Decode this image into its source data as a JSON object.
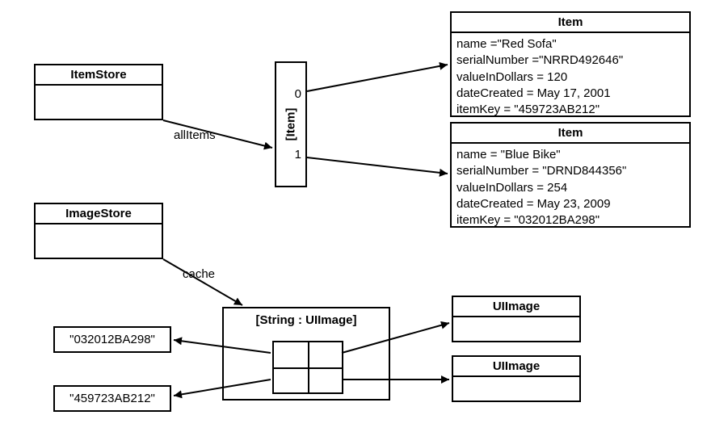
{
  "itemStore": {
    "title": "ItemStore"
  },
  "imageStore": {
    "title": "ImageStore"
  },
  "itemArray": {
    "label": "[Item]",
    "indices": [
      "0",
      "1"
    ]
  },
  "items": [
    {
      "title": "Item",
      "name": "name =\"Red Sofa\"",
      "serial": "serialNumber =\"NRRD492646\"",
      "value": "valueInDollars = 120",
      "date": "dateCreated = May 17, 2001",
      "key": "itemKey = \"459723AB212\""
    },
    {
      "title": "Item",
      "name": "name = \"Blue Bike\"",
      "serial": "serialNumber = \"DRND844356\"",
      "value": "valueInDollars = 254",
      "date": "dateCreated = May 23, 2009",
      "key": "itemKey = \"032012BA298\""
    }
  ],
  "dict": {
    "title": "[String : UIImage]"
  },
  "uiimage": {
    "title0": "UIImage",
    "title1": "UIImage"
  },
  "keys": {
    "k0": "\"032012BA298\"",
    "k1": "\"459723AB212\""
  },
  "labels": {
    "allItems": "allItems",
    "cache": "cache"
  }
}
